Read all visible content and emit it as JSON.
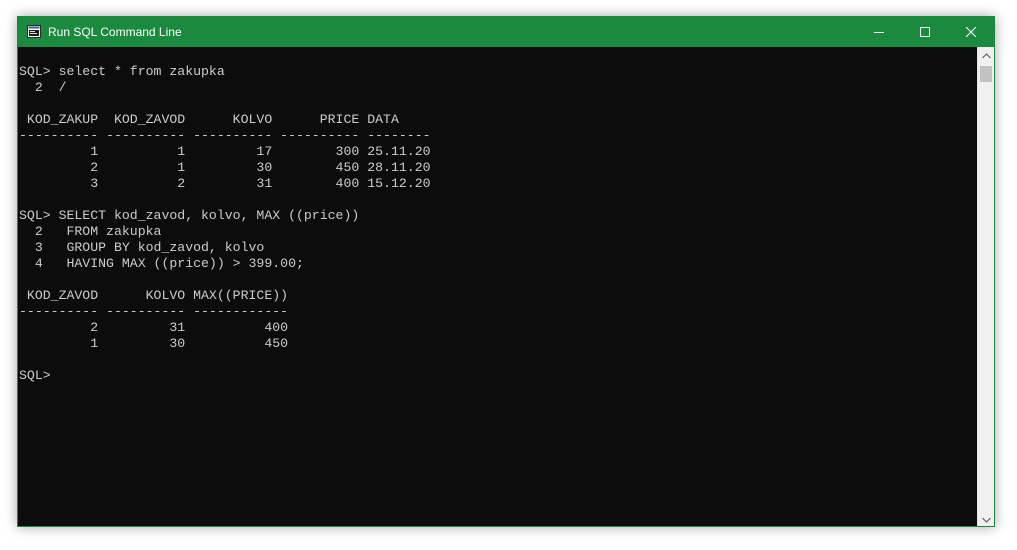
{
  "window": {
    "title": "Run SQL Command Line",
    "accent_color": "#1b8a3e",
    "icon": "sql-app-icon",
    "controls": {
      "minimize_icon": "minimize-icon",
      "maximize_icon": "maximize-icon",
      "close_icon": "close-icon"
    }
  },
  "console": {
    "lines": [
      "SQL> select * from zakupka",
      "  2  /",
      "",
      " KOD_ZAKUP  KOD_ZAVOD      KOLVO      PRICE DATA",
      "---------- ---------- ---------- ---------- --------",
      "         1          1         17        300 25.11.20",
      "         2          1         30        450 28.11.20",
      "         3          2         31        400 15.12.20",
      "",
      "SQL> SELECT kod_zavod, kolvo, MAX ((price))",
      "  2   FROM zakupka",
      "  3   GROUP BY kod_zavod, kolvo",
      "  4   HAVING MAX ((price)) > 399.00;",
      "",
      " KOD_ZAVOD      KOLVO MAX((PRICE))",
      "---------- ---------- ------------",
      "         2         31          400",
      "         1         30          450",
      "",
      "SQL> "
    ]
  },
  "scrollbar": {
    "up_icon": "scroll-up-arrow-icon",
    "down_icon": "scroll-down-arrow-icon"
  }
}
